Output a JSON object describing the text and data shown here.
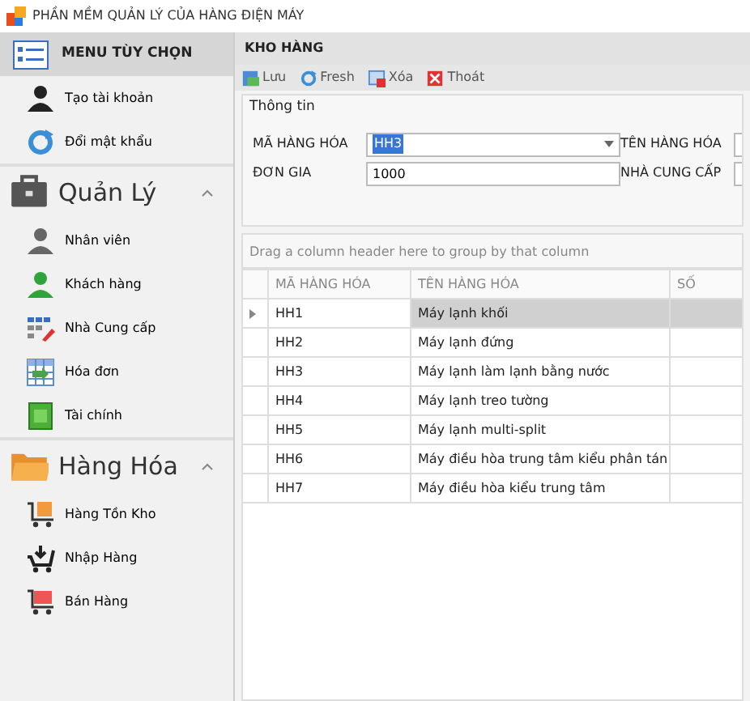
{
  "window": {
    "title": "PHẦN MỀM QUẢN LÝ CỦA HÀNG ĐIỆN MÁY"
  },
  "sidebar": {
    "title": "MENU TÙY CHỌN",
    "items": [
      {
        "label": "Tạo tài khoản"
      },
      {
        "label": "Đổi mật khẩu"
      }
    ],
    "groups": [
      {
        "title": "Quản Lý",
        "expanded": true,
        "items": [
          {
            "label": "Nhân viên"
          },
          {
            "label": "Khách hàng"
          },
          {
            "label": "Nhà Cung cấp"
          },
          {
            "label": "Hóa đơn"
          },
          {
            "label": "Tài chính"
          }
        ]
      },
      {
        "title": "Hàng Hóa",
        "expanded": true,
        "items": [
          {
            "label": "Hàng Tồn Kho"
          },
          {
            "label": "Nhập Hàng"
          },
          {
            "label": "Bán Hàng"
          }
        ]
      }
    ]
  },
  "panel": {
    "title": "KHO HÀNG",
    "toolbar": [
      {
        "label": "Lưu"
      },
      {
        "label": "Fresh"
      },
      {
        "label": "Xóa"
      },
      {
        "label": "Thoát"
      }
    ],
    "group_title": "Thông tin",
    "fields": [
      {
        "label": "MÃ HÀNG HÓA",
        "kind": "combo",
        "value": "HH3"
      },
      {
        "label": "TÊN HÀNG HÓA",
        "kind": "text"
      },
      {
        "label": "ĐƠN GIA",
        "kind": "text",
        "value": "1000"
      },
      {
        "label": "NHÀ CUNG CẤP",
        "kind": "text"
      }
    ]
  },
  "table": {
    "group_hint": "Drag a column header here to group by that column",
    "columns": [
      "MÃ HÀNG HÓA",
      "TÊN HÀNG HÓA",
      "SỐ"
    ],
    "rows": [
      {
        "cells": [
          "HH1",
          "Máy lạnh khối"
        ],
        "selected": true
      },
      {
        "cells": [
          "HH2",
          "Máy lạnh đứng"
        ],
        "selected": false
      },
      {
        "cells": [
          "HH3",
          "Máy lạnh làm lạnh bằng nước"
        ],
        "selected": false
      },
      {
        "cells": [
          "HH4",
          "Máy lạnh treo tường"
        ],
        "selected": false
      },
      {
        "cells": [
          "HH5",
          "Máy lạnh multi-split"
        ],
        "selected": false
      },
      {
        "cells": [
          "HH6",
          "Máy điều hòa trung tâm kiểu phân tán"
        ],
        "selected": false
      },
      {
        "cells": [
          "HH7",
          "Máy điều hòa kiểu trung tâm"
        ],
        "selected": false
      }
    ]
  }
}
